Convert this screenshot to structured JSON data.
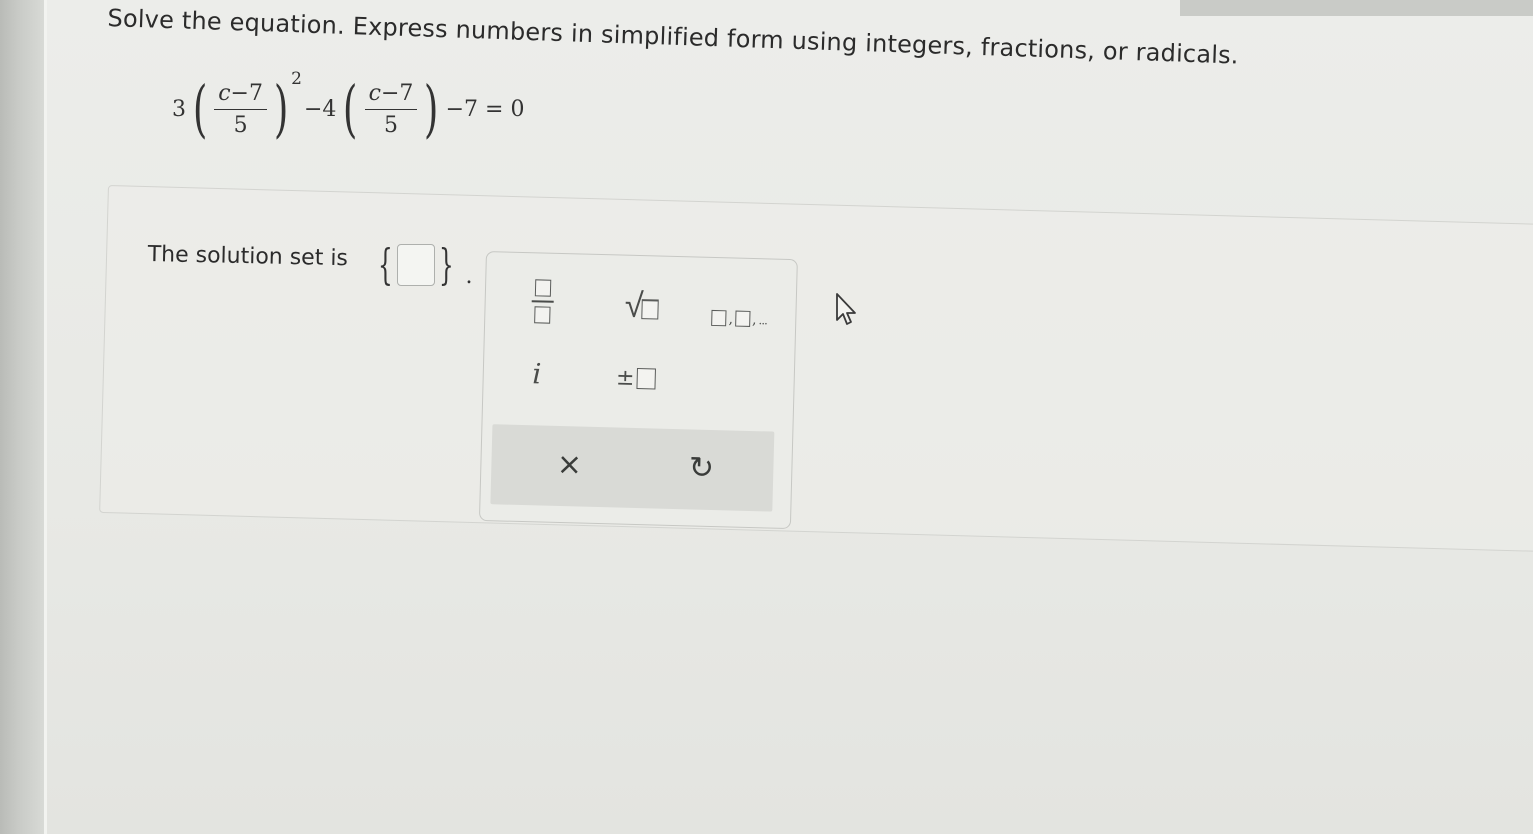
{
  "instructions": "Solve the equation. Express numbers in simplified form using integers, fractions, or radicals.",
  "equation": {
    "coef1": "3",
    "numerator_var": "c",
    "numerator_rest": "−7",
    "denominator": "5",
    "exponent": "2",
    "coef2": "−4",
    "tail": "−7 = 0"
  },
  "answer": {
    "label": "The solution set is",
    "open_brace": "{",
    "close_brace": "}",
    "period": ".",
    "value": ""
  },
  "palette": {
    "icons": [
      "fraction-icon",
      "sqrt-icon",
      "list-icon",
      "imaginary-icon",
      "plus-minus-icon",
      "clear-icon",
      "undo-icon"
    ],
    "i_label": "i",
    "pm_label": "±",
    "sqrt_label": "√",
    "list_sep": ",",
    "list_ellipsis": "...",
    "clear_label": "×",
    "undo_label": "↻"
  }
}
